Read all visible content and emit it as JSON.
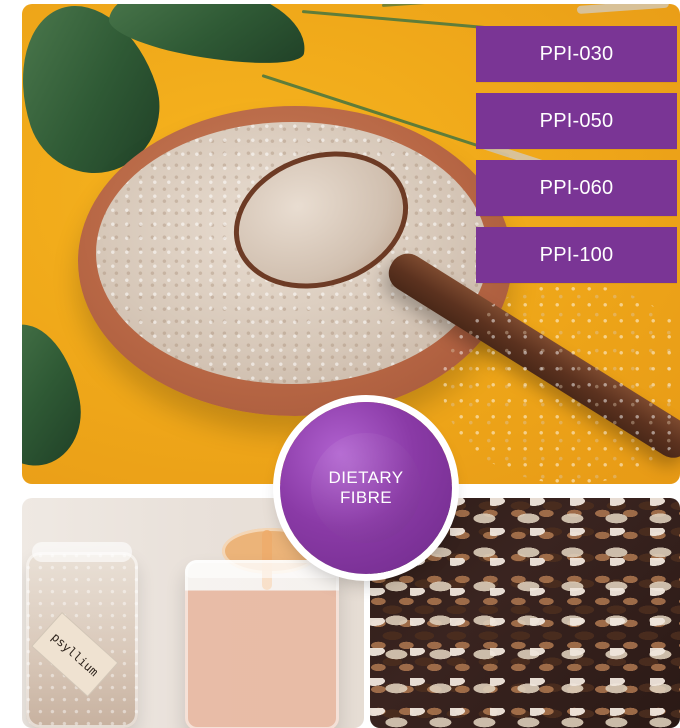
{
  "codes": {
    "items": [
      "PPI-030",
      "PPI-050",
      "PPI-060",
      "PPI-100"
    ]
  },
  "badge": {
    "line1": "DIETARY",
    "line2": "FIBRE"
  },
  "jar_tag": {
    "text": "psyllium"
  }
}
